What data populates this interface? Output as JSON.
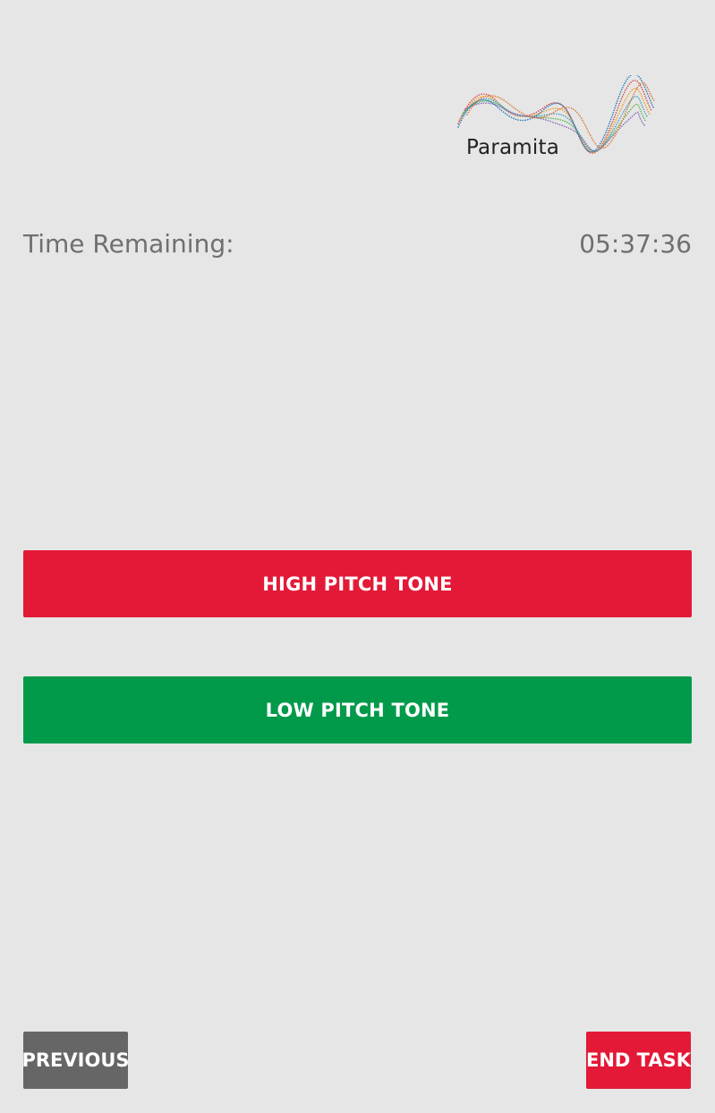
{
  "logo": {
    "text": "Paramita",
    "icon": "wave-dots-icon"
  },
  "timer": {
    "label": "Time Remaining:",
    "value": "05:37:36"
  },
  "tones": {
    "high_label": "HIGH PITCH TONE",
    "low_label": "LOW PITCH TONE"
  },
  "nav": {
    "previous_label": "PREVIOUS",
    "end_label": "END TASK"
  },
  "colors": {
    "background": "#e6e6e6",
    "high_tone": "#e31937",
    "low_tone": "#009a4a",
    "previous": "#666666",
    "end_task": "#e31937",
    "timer_text": "#6f6f6f"
  }
}
